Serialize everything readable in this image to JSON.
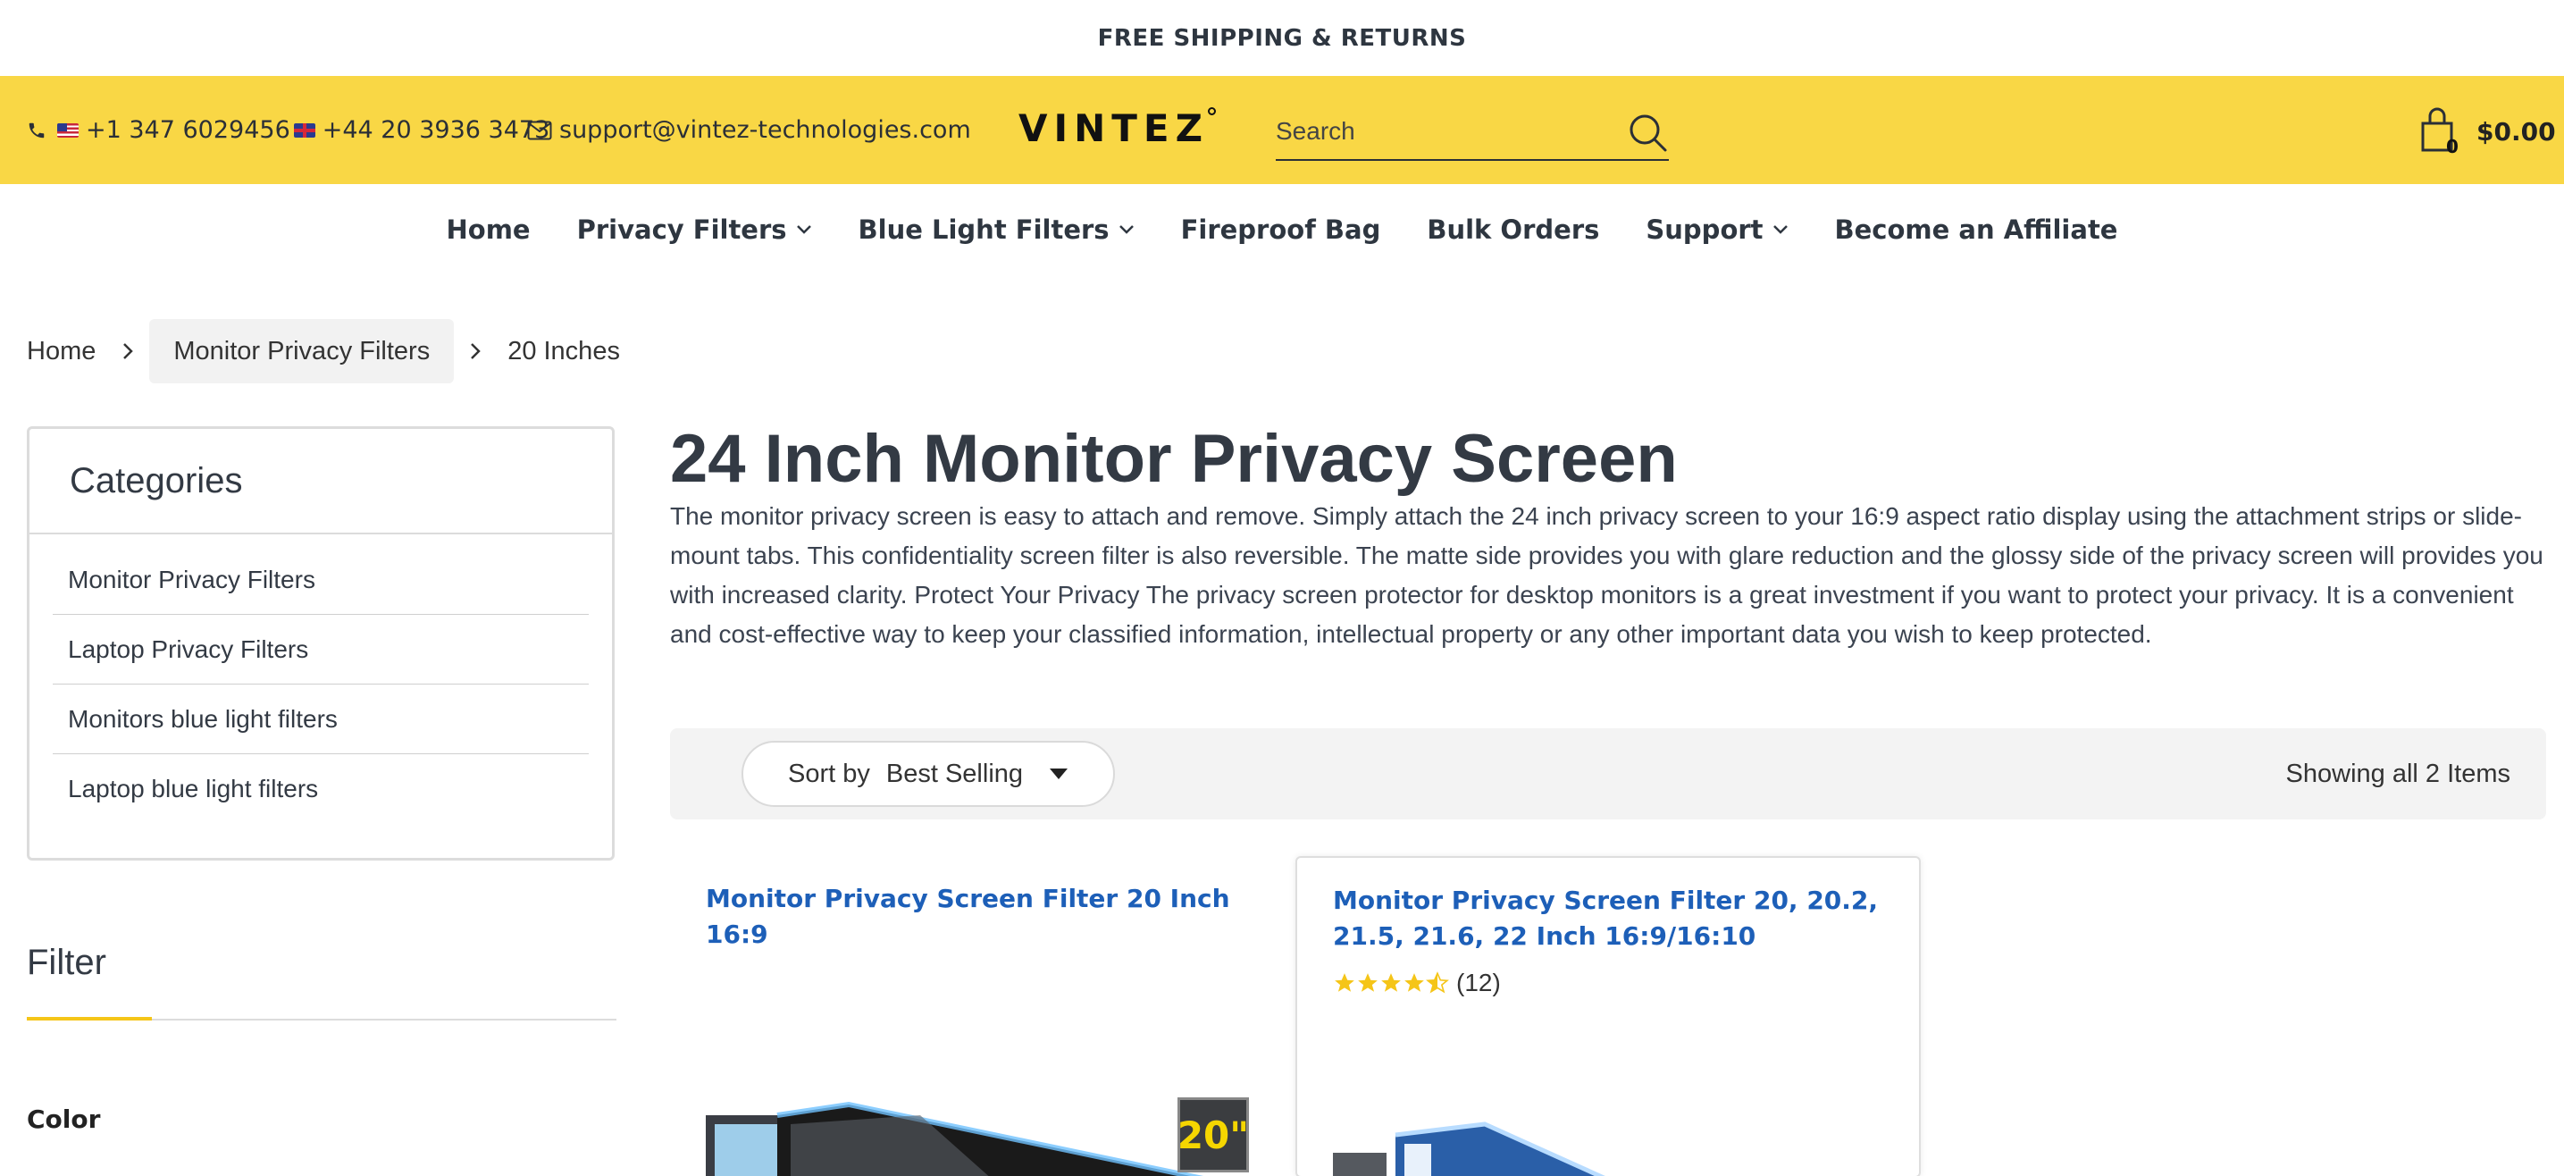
{
  "announcement": "FREE SHIPPING & RETURNS",
  "header": {
    "phone_us": "+1 347 6029456",
    "phone_uk": "+44 20 3936 3473",
    "email": "support@vintez-technologies.com",
    "logo_text": "VINTEZ",
    "search_placeholder": "Search",
    "cart_count": "0",
    "cart_total": "$0.00",
    "accent_color": "#f9d745"
  },
  "nav": {
    "items": [
      {
        "label": "Home"
      },
      {
        "label": "Privacy Filters"
      },
      {
        "label": "Blue Light Filters"
      },
      {
        "label": "Fireproof Bag"
      },
      {
        "label": "Bulk Orders"
      },
      {
        "label": "Support"
      },
      {
        "label": "Become an Affiliate"
      }
    ]
  },
  "breadcrumb": [
    "Home",
    "Monitor Privacy Filters",
    "20 Inches"
  ],
  "sidebar": {
    "categories_title": "Categories",
    "categories": [
      "Monitor Privacy Filters",
      "Laptop Privacy Filters",
      "Monitors blue light filters",
      "Laptop blue light filters"
    ],
    "filter_title": "Filter",
    "color_label": "Color"
  },
  "main": {
    "title": "24 Inch Monitor Privacy Screen",
    "description": "The monitor privacy screen is easy to attach and remove. Simply attach the 24 inch privacy screen to your 16:9 aspect ratio display using the attachment strips or slide-mount tabs. This confidentiality screen filter is also reversible. The matte side provides you with glare reduction and the glossy side of the privacy screen will provides you with increased clarity. Protect Your Privacy The privacy screen protector for desktop monitors is a great investment if you want to protect your privacy. It is a convenient and cost-effective way to keep your classified information, intellectual property or any other important data you wish to keep protected.",
    "sort_label": "Sort by",
    "sort_value": "Best Selling",
    "showing": "Showing all 2 Items"
  },
  "products": [
    {
      "title": "Monitor Privacy Screen Filter 20 Inch 16:9",
      "badge": "20\""
    },
    {
      "title": "Monitor Privacy Screen Filter 20, 20.2, 21.5, 21.6, 22 Inch 16:9/16:10",
      "rating": 4.5,
      "reviews": "(12)"
    }
  ]
}
